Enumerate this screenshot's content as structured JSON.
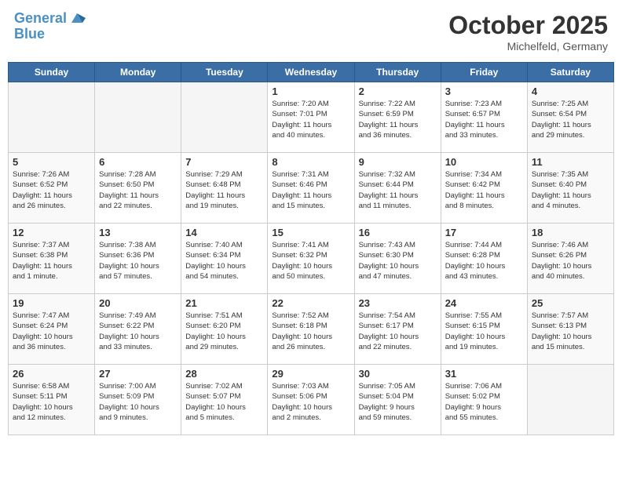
{
  "header": {
    "logo_line1": "General",
    "logo_line2": "Blue",
    "month": "October 2025",
    "location": "Michelfeld, Germany"
  },
  "weekdays": [
    "Sunday",
    "Monday",
    "Tuesday",
    "Wednesday",
    "Thursday",
    "Friday",
    "Saturday"
  ],
  "weeks": [
    [
      {
        "day": "",
        "info": "",
        "empty": true
      },
      {
        "day": "",
        "info": "",
        "empty": true
      },
      {
        "day": "",
        "info": "",
        "empty": true
      },
      {
        "day": "1",
        "info": "Sunrise: 7:20 AM\nSunset: 7:01 PM\nDaylight: 11 hours\nand 40 minutes."
      },
      {
        "day": "2",
        "info": "Sunrise: 7:22 AM\nSunset: 6:59 PM\nDaylight: 11 hours\nand 36 minutes."
      },
      {
        "day": "3",
        "info": "Sunrise: 7:23 AM\nSunset: 6:57 PM\nDaylight: 11 hours\nand 33 minutes."
      },
      {
        "day": "4",
        "info": "Sunrise: 7:25 AM\nSunset: 6:54 PM\nDaylight: 11 hours\nand 29 minutes.",
        "weekend": true
      }
    ],
    [
      {
        "day": "5",
        "info": "Sunrise: 7:26 AM\nSunset: 6:52 PM\nDaylight: 11 hours\nand 26 minutes.",
        "weekend": true
      },
      {
        "day": "6",
        "info": "Sunrise: 7:28 AM\nSunset: 6:50 PM\nDaylight: 11 hours\nand 22 minutes."
      },
      {
        "day": "7",
        "info": "Sunrise: 7:29 AM\nSunset: 6:48 PM\nDaylight: 11 hours\nand 19 minutes."
      },
      {
        "day": "8",
        "info": "Sunrise: 7:31 AM\nSunset: 6:46 PM\nDaylight: 11 hours\nand 15 minutes."
      },
      {
        "day": "9",
        "info": "Sunrise: 7:32 AM\nSunset: 6:44 PM\nDaylight: 11 hours\nand 11 minutes."
      },
      {
        "day": "10",
        "info": "Sunrise: 7:34 AM\nSunset: 6:42 PM\nDaylight: 11 hours\nand 8 minutes."
      },
      {
        "day": "11",
        "info": "Sunrise: 7:35 AM\nSunset: 6:40 PM\nDaylight: 11 hours\nand 4 minutes.",
        "weekend": true
      }
    ],
    [
      {
        "day": "12",
        "info": "Sunrise: 7:37 AM\nSunset: 6:38 PM\nDaylight: 11 hours\nand 1 minute.",
        "weekend": true
      },
      {
        "day": "13",
        "info": "Sunrise: 7:38 AM\nSunset: 6:36 PM\nDaylight: 10 hours\nand 57 minutes."
      },
      {
        "day": "14",
        "info": "Sunrise: 7:40 AM\nSunset: 6:34 PM\nDaylight: 10 hours\nand 54 minutes."
      },
      {
        "day": "15",
        "info": "Sunrise: 7:41 AM\nSunset: 6:32 PM\nDaylight: 10 hours\nand 50 minutes."
      },
      {
        "day": "16",
        "info": "Sunrise: 7:43 AM\nSunset: 6:30 PM\nDaylight: 10 hours\nand 47 minutes."
      },
      {
        "day": "17",
        "info": "Sunrise: 7:44 AM\nSunset: 6:28 PM\nDaylight: 10 hours\nand 43 minutes."
      },
      {
        "day": "18",
        "info": "Sunrise: 7:46 AM\nSunset: 6:26 PM\nDaylight: 10 hours\nand 40 minutes.",
        "weekend": true
      }
    ],
    [
      {
        "day": "19",
        "info": "Sunrise: 7:47 AM\nSunset: 6:24 PM\nDaylight: 10 hours\nand 36 minutes.",
        "weekend": true
      },
      {
        "day": "20",
        "info": "Sunrise: 7:49 AM\nSunset: 6:22 PM\nDaylight: 10 hours\nand 33 minutes."
      },
      {
        "day": "21",
        "info": "Sunrise: 7:51 AM\nSunset: 6:20 PM\nDaylight: 10 hours\nand 29 minutes."
      },
      {
        "day": "22",
        "info": "Sunrise: 7:52 AM\nSunset: 6:18 PM\nDaylight: 10 hours\nand 26 minutes."
      },
      {
        "day": "23",
        "info": "Sunrise: 7:54 AM\nSunset: 6:17 PM\nDaylight: 10 hours\nand 22 minutes."
      },
      {
        "day": "24",
        "info": "Sunrise: 7:55 AM\nSunset: 6:15 PM\nDaylight: 10 hours\nand 19 minutes."
      },
      {
        "day": "25",
        "info": "Sunrise: 7:57 AM\nSunset: 6:13 PM\nDaylight: 10 hours\nand 15 minutes.",
        "weekend": true
      }
    ],
    [
      {
        "day": "26",
        "info": "Sunrise: 6:58 AM\nSunset: 5:11 PM\nDaylight: 10 hours\nand 12 minutes.",
        "weekend": true
      },
      {
        "day": "27",
        "info": "Sunrise: 7:00 AM\nSunset: 5:09 PM\nDaylight: 10 hours\nand 9 minutes."
      },
      {
        "day": "28",
        "info": "Sunrise: 7:02 AM\nSunset: 5:07 PM\nDaylight: 10 hours\nand 5 minutes."
      },
      {
        "day": "29",
        "info": "Sunrise: 7:03 AM\nSunset: 5:06 PM\nDaylight: 10 hours\nand 2 minutes."
      },
      {
        "day": "30",
        "info": "Sunrise: 7:05 AM\nSunset: 5:04 PM\nDaylight: 9 hours\nand 59 minutes."
      },
      {
        "day": "31",
        "info": "Sunrise: 7:06 AM\nSunset: 5:02 PM\nDaylight: 9 hours\nand 55 minutes."
      },
      {
        "day": "",
        "info": "",
        "empty": true
      }
    ]
  ]
}
